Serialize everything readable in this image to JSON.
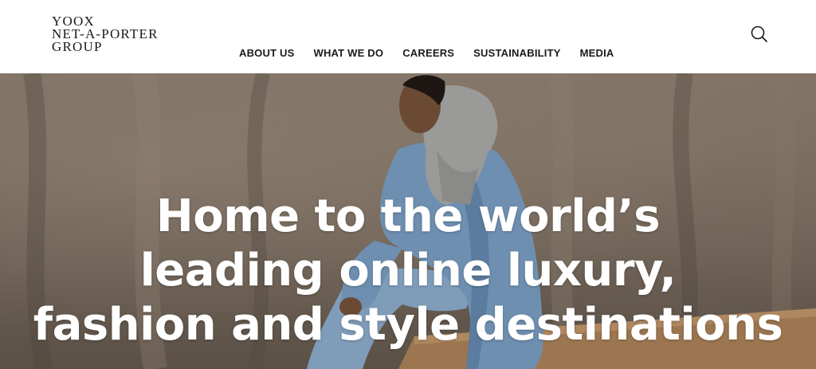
{
  "logo": {
    "line1": "YOOX",
    "line2": "NET-A-PORTER",
    "line3": "GROUP"
  },
  "nav": {
    "items": [
      {
        "label": "ABOUT US"
      },
      {
        "label": "WHAT WE DO"
      },
      {
        "label": "CAREERS"
      },
      {
        "label": "SUSTAINABILITY"
      },
      {
        "label": "MEDIA"
      }
    ]
  },
  "header": {
    "search_icon": "search-icon"
  },
  "hero": {
    "line1": "Home to the world’s",
    "line2": "leading online luxury,",
    "line3": "fashion and style destinations",
    "image": "model-in-denim-jacket-photo"
  },
  "colors": {
    "text": "#1a1a1a",
    "hero_text": "#ffffff",
    "hero_backdrop": "#75695d",
    "denim": "#6e8fb0",
    "hoodie": "#9a9a98"
  }
}
